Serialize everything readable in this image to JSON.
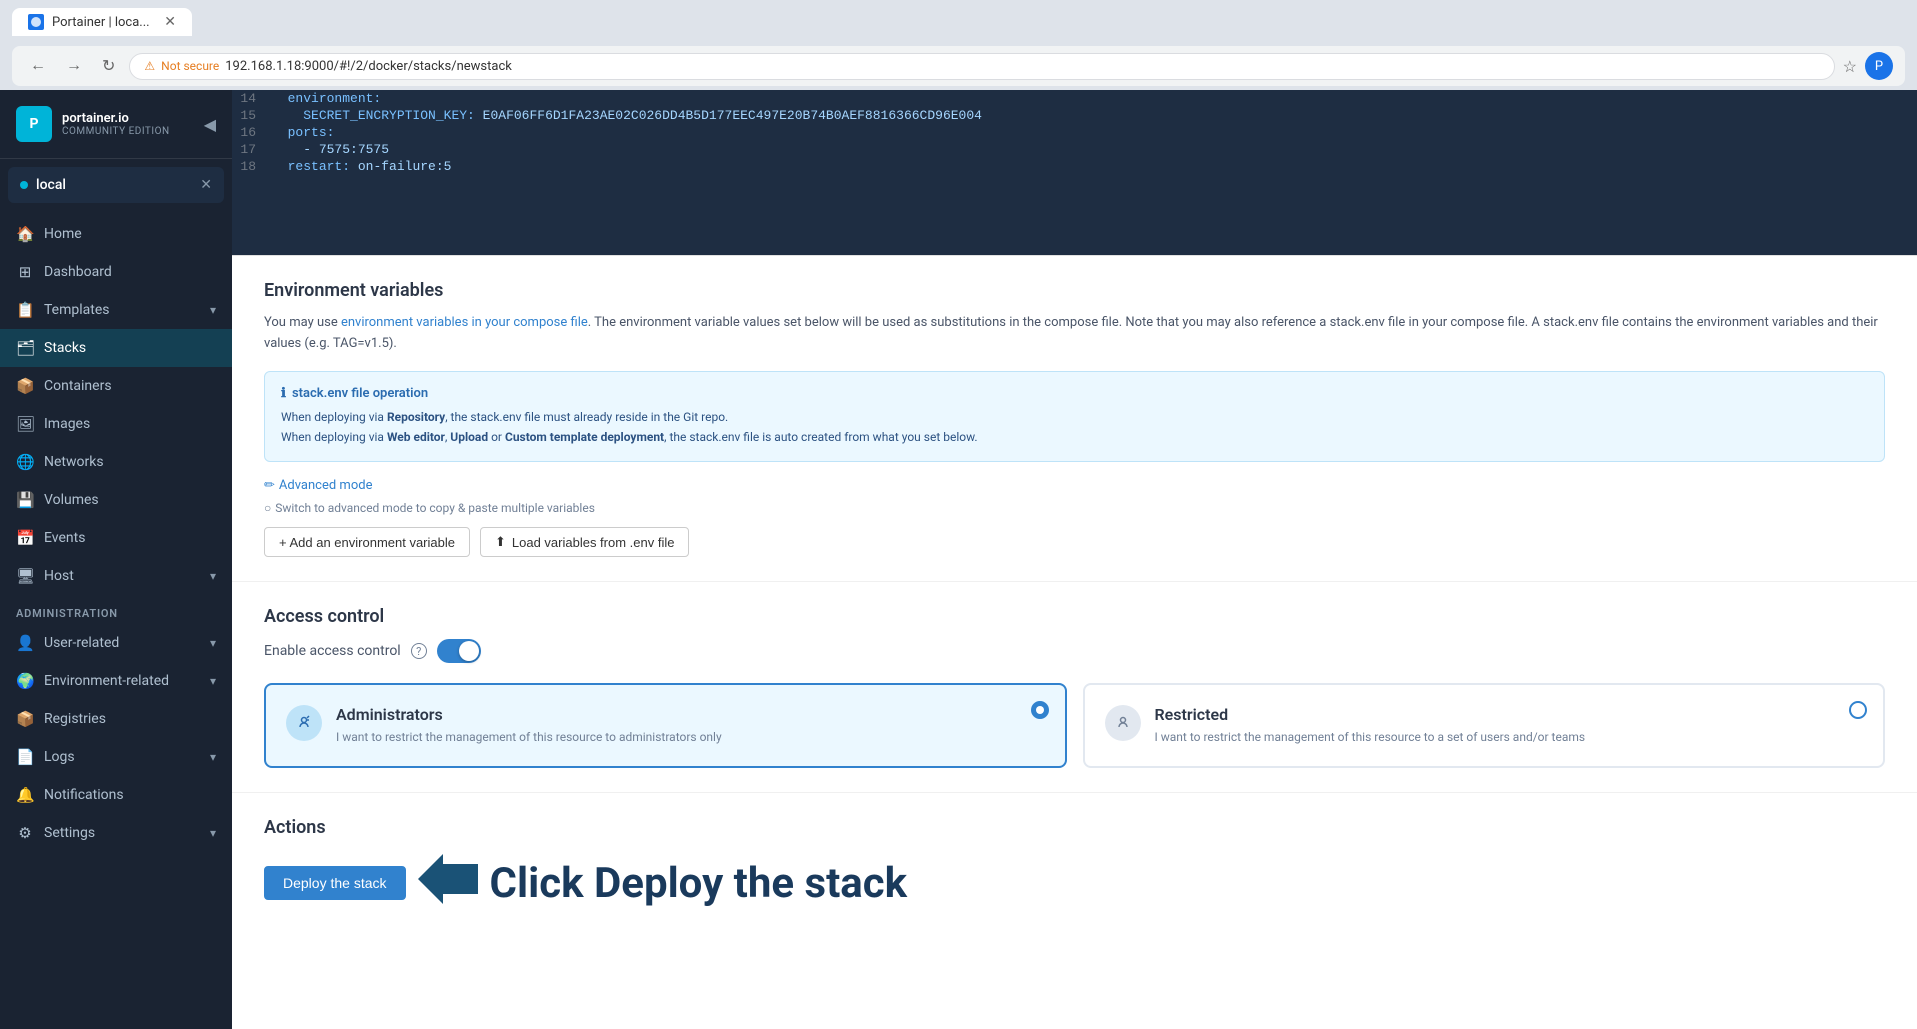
{
  "browser": {
    "tab_title": "Portainer | loca...",
    "url": "192.168.1.18:9000/#!/2/docker/stacks/newstack",
    "not_secure_label": "Not secure"
  },
  "sidebar": {
    "logo_text": "portainer.io",
    "logo_sub": "COMMUNITY EDITION",
    "env_name": "local",
    "nav_items": [
      {
        "id": "home",
        "label": "Home",
        "icon": "🏠"
      },
      {
        "id": "dashboard",
        "label": "Dashboard",
        "icon": "⊞"
      },
      {
        "id": "templates",
        "label": "Templates",
        "icon": "📋",
        "has_chevron": true
      },
      {
        "id": "stacks",
        "label": "Stacks",
        "icon": "🗂",
        "active": true
      },
      {
        "id": "containers",
        "label": "Containers",
        "icon": "📦"
      },
      {
        "id": "images",
        "label": "Images",
        "icon": "🖼"
      },
      {
        "id": "networks",
        "label": "Networks",
        "icon": "🌐"
      },
      {
        "id": "volumes",
        "label": "Volumes",
        "icon": "💾"
      },
      {
        "id": "events",
        "label": "Events",
        "icon": "📅"
      },
      {
        "id": "host",
        "label": "Host",
        "icon": "🖥",
        "has_chevron": true
      }
    ],
    "admin_section": "Administration",
    "admin_items": [
      {
        "id": "user-related",
        "label": "User-related",
        "icon": "👤",
        "has_chevron": true
      },
      {
        "id": "environment-related",
        "label": "Environment-related",
        "icon": "🌍",
        "has_chevron": true
      },
      {
        "id": "registries",
        "label": "Registries",
        "icon": "📦"
      },
      {
        "id": "logs",
        "label": "Logs",
        "icon": "📄",
        "has_chevron": true
      },
      {
        "id": "notifications",
        "label": "Notifications",
        "icon": "🔔"
      },
      {
        "id": "settings",
        "label": "Settings",
        "icon": "⚙",
        "has_chevron": true
      }
    ]
  },
  "code_editor": {
    "lines": [
      {
        "num": "14",
        "content": "  environment:"
      },
      {
        "num": "15",
        "content": "    SECRET_ENCRYPTION_KEY: E0AF06FF6D1FA23AE02C026DD4B5D177EEC497E20B74B0AEF8816366CD96E004"
      },
      {
        "num": "16",
        "content": "  ports:"
      },
      {
        "num": "17",
        "content": "    - 7575:7575"
      },
      {
        "num": "18",
        "content": "  restart: on-failure:5"
      }
    ]
  },
  "env_section": {
    "title": "Environment variables",
    "description_start": "You may use ",
    "description_link": "environment variables in your compose file",
    "description_end": ". The environment variable values set below will be used as substitutions in the compose file. Note that you may also reference a stack.env file in your compose file. A stack.env file contains the environment variables and their values (e.g. TAG=v1.5).",
    "info_box": {
      "title": "stack.env file operation",
      "line1_start": "When deploying via ",
      "line1_bold": "Repository",
      "line1_end": ", the stack.env file must already reside in the Git repo.",
      "line2_start": "When deploying via ",
      "line2_bold1": "Web editor",
      "line2_sep1": ", ",
      "line2_bold2": "Upload",
      "line2_sep2": " or ",
      "line2_bold3": "Custom template deployment",
      "line2_end": ", the stack.env file is auto created from what you set below."
    },
    "advanced_mode_label": "Advanced mode",
    "advanced_mode_hint": "Switch to advanced mode to copy & paste multiple variables",
    "add_env_var_btn": "+ Add an environment variable",
    "load_env_btn": "Load variables from .env file"
  },
  "access_control": {
    "title": "Access control",
    "enable_label": "Enable access control",
    "help_icon": "?",
    "cards": [
      {
        "id": "administrators",
        "title": "Administrators",
        "description": "I want to restrict the management of this resource to administrators only",
        "icon": "🚫",
        "selected": true
      },
      {
        "id": "restricted",
        "title": "Restricted",
        "description": "I want to restrict the management of this resource to a set of users and/or teams",
        "icon": "👤",
        "selected": false
      }
    ]
  },
  "actions": {
    "title": "Actions",
    "deploy_btn": "Deploy the stack",
    "annotation_text": "Click Deploy the stack"
  }
}
